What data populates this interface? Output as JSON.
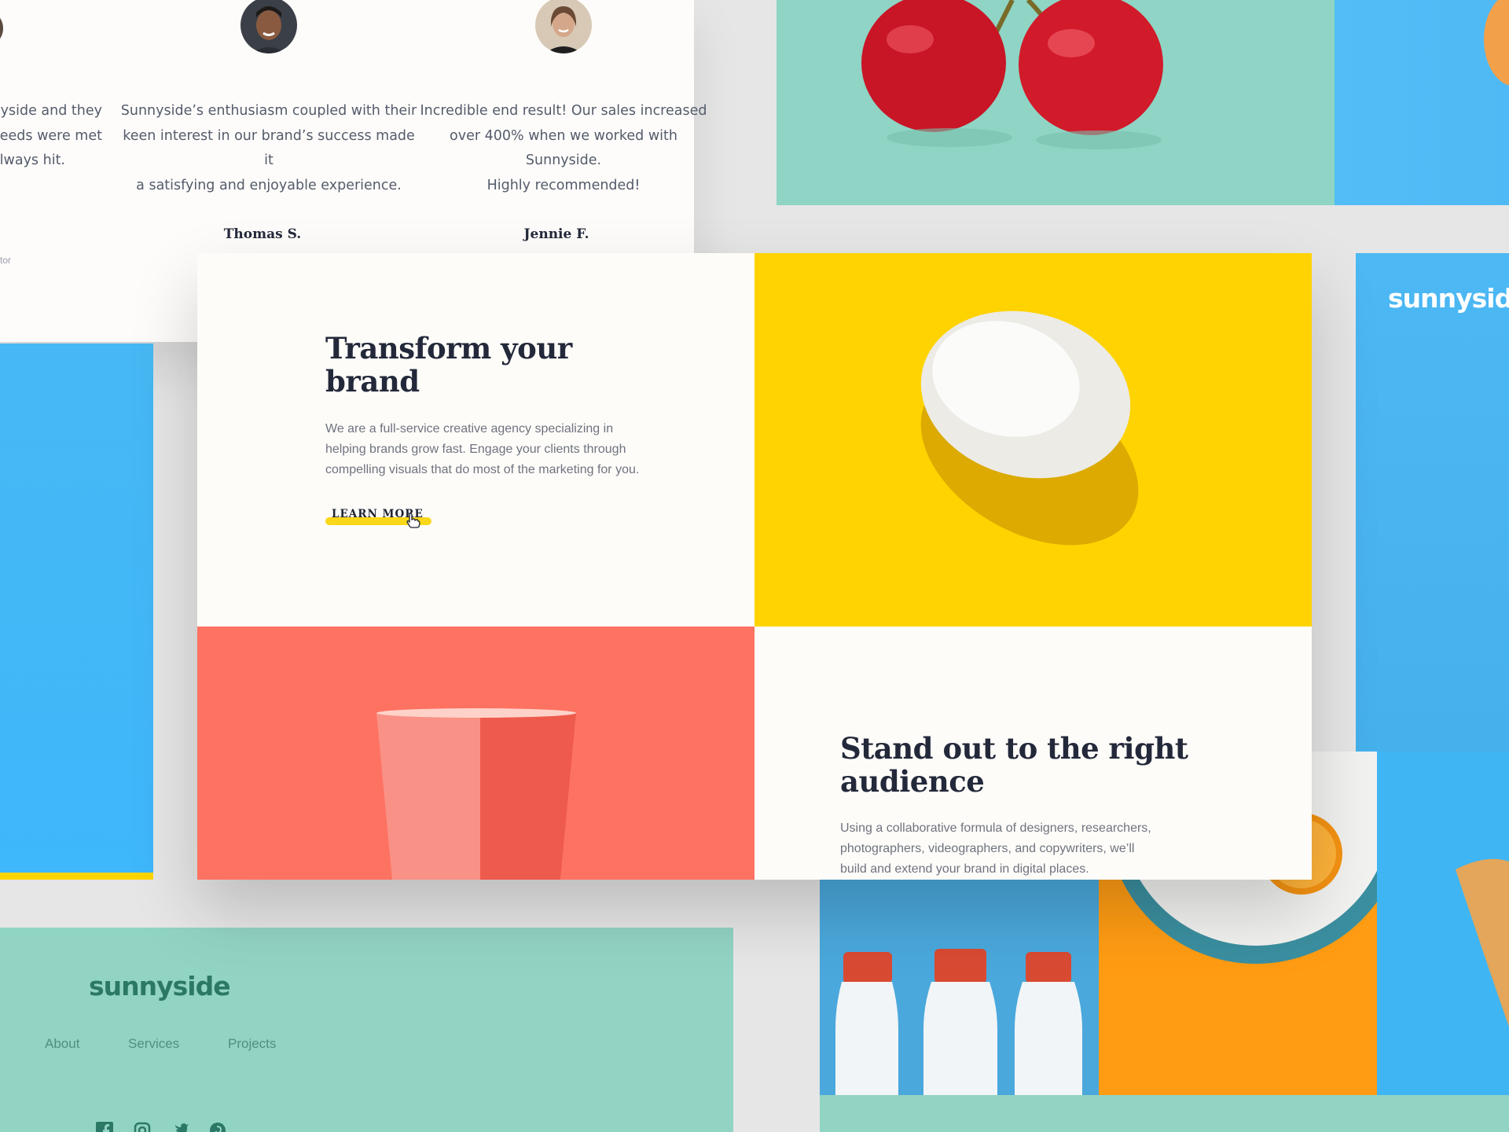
{
  "testimonials": [
    {
      "quote_lines": [
        "nyside and they",
        "r needs were met",
        "always hit."
      ],
      "name": "",
      "role": "tor"
    },
    {
      "quote_lines": [
        "Sunnyside’s enthusiasm coupled with their",
        "keen interest in our brand’s success made it",
        "a satisfying and enjoyable experience."
      ],
      "name": "Thomas S."
    },
    {
      "quote_lines": [
        "Incredible end result! Our sales increased",
        "over 400% when we worked with Sunnyside.",
        "Highly recommended!"
      ],
      "name": "Jennie F."
    }
  ],
  "feature1": {
    "heading_lines": [
      "Transform your",
      "brand"
    ],
    "body_lines": [
      "We are a full-service creative agency specializing in",
      "helping brands grow fast. Engage your clients through",
      "compelling visuals that do most of the marketing for you."
    ],
    "cta": "LEARN MORE"
  },
  "feature2": {
    "heading_lines": [
      "Stand out to the right",
      "audience"
    ],
    "body_lines": [
      "Using a collaborative formula of designers, researchers,",
      "photographers, videographers, and copywriters, we’ll",
      "build and extend your brand in digital places."
    ]
  },
  "side_logo": "sunnyside",
  "footer": {
    "logo": "sunnyside",
    "links": [
      "About",
      "Services",
      "Projects"
    ],
    "social_icons": [
      "facebook-icon",
      "instagram-icon",
      "twitter-icon",
      "pinterest-icon"
    ]
  },
  "colors": {
    "yellow": "#fed300",
    "coral": "#fe7262",
    "blue": "#45b6f3",
    "teal": "#92d4c4",
    "dark": "#23293a"
  }
}
